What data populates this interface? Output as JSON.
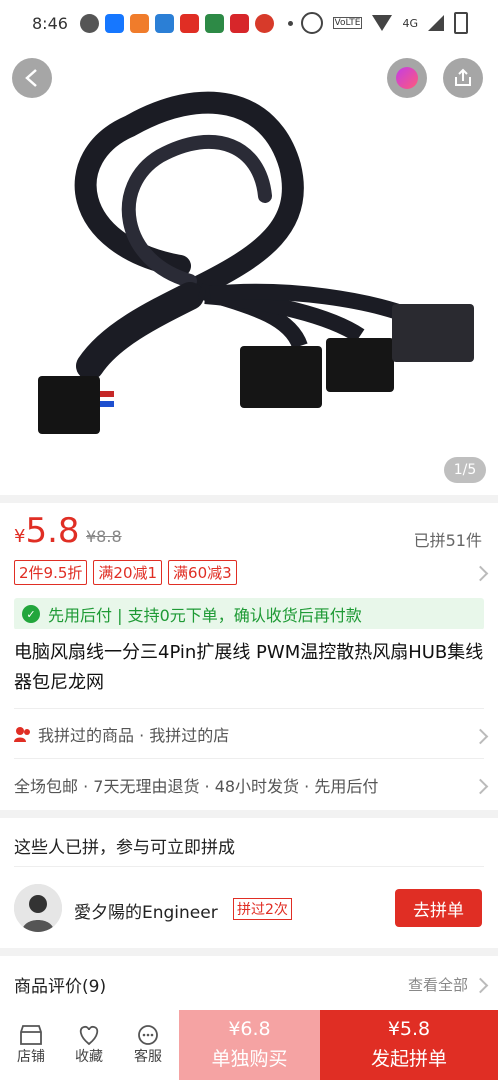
{
  "status_bar": {
    "time": "8:46",
    "signal_text": "4G",
    "volte": "VoLTE"
  },
  "hero": {
    "pager": "1/5"
  },
  "price": {
    "symbol": "¥",
    "current": "5.8",
    "original": "¥8.8",
    "sold": "已拼51件"
  },
  "tags": [
    "2件9.5折",
    "满20减1",
    "满60减3"
  ],
  "promo": "先用后付 | 支持0元下单，确认收货后再付款",
  "product_title": "电脑风扇线一分三4Pin扩展线 PWM温控散热风扇HUB集线器包尼龙网",
  "history": {
    "text": "我拼过的商品 · 我拼过的店"
  },
  "services": "全场包邮 · 7天无理由退货 · 48小时发货 · 先用后付",
  "group_section": {
    "header": "这些人已拼，参与可立即拼成",
    "user_name": "愛夕陽的Engineer",
    "badge": "拼过2次",
    "join_label": "去拼单"
  },
  "reviews": {
    "header": "商品评价(9)",
    "view_all": "查看全部"
  },
  "bottom_bar": {
    "tabs": [
      {
        "label": "店铺",
        "icon": "store-icon"
      },
      {
        "label": "收藏",
        "icon": "heart-icon"
      },
      {
        "label": "客服",
        "icon": "chat-icon"
      }
    ],
    "solo": {
      "price": "¥6.8",
      "label": "单独购买"
    },
    "group": {
      "price": "¥5.8",
      "label": "发起拼单"
    }
  },
  "colors": {
    "accent": "#e02e24",
    "green": "#1e9a35"
  }
}
